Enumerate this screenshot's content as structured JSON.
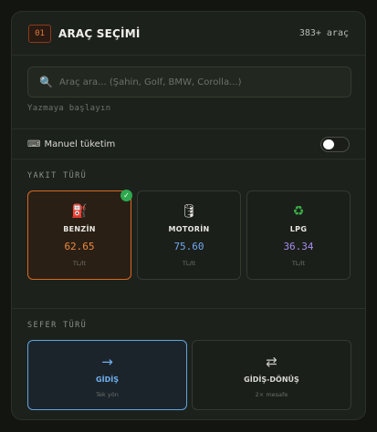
{
  "header": {
    "step": "01",
    "title": "ARAÇ SEÇİMİ",
    "count": "383+ araç"
  },
  "search": {
    "icon": "search-icon",
    "placeholder": "Araç ara... (Şahin, Golf, BMW, Corolla...)",
    "value": "",
    "hint": "Yazmaya başlayın"
  },
  "manual": {
    "icon": "keyboard-icon",
    "label": "Manuel tüketim",
    "enabled": false
  },
  "fuel_section": {
    "label": "YAKIT TÜRÜ",
    "options": [
      {
        "icon": "⛽",
        "name": "BENZİN",
        "price": "62.65",
        "unit": "TL/lt",
        "selected": true,
        "price_color": "#f08a3e"
      },
      {
        "icon": "🛢",
        "name": "MOTORİN",
        "price": "75.60",
        "unit": "TL/lt",
        "selected": false,
        "price_color": "#6fa8f0"
      },
      {
        "icon": "♻",
        "name": "LPG",
        "price": "36.34",
        "unit": "TL/lt",
        "selected": false,
        "price_color": "#a58cf0"
      }
    ]
  },
  "trip_section": {
    "label": "SEFER TÜRÜ",
    "options": [
      {
        "icon": "→",
        "name": "GİDİŞ",
        "sub": "Tek yön",
        "selected": true,
        "color": "#6fb0ef"
      },
      {
        "icon": "⇄",
        "name": "GİDİŞ-DÖNÜŞ",
        "sub": "2× mesafe",
        "selected": false,
        "color": "#d8d9d2"
      }
    ]
  },
  "colors": {
    "accent": "#d8691f",
    "selected_trip": "#5fa3e0",
    "check": "#2ea84f"
  }
}
